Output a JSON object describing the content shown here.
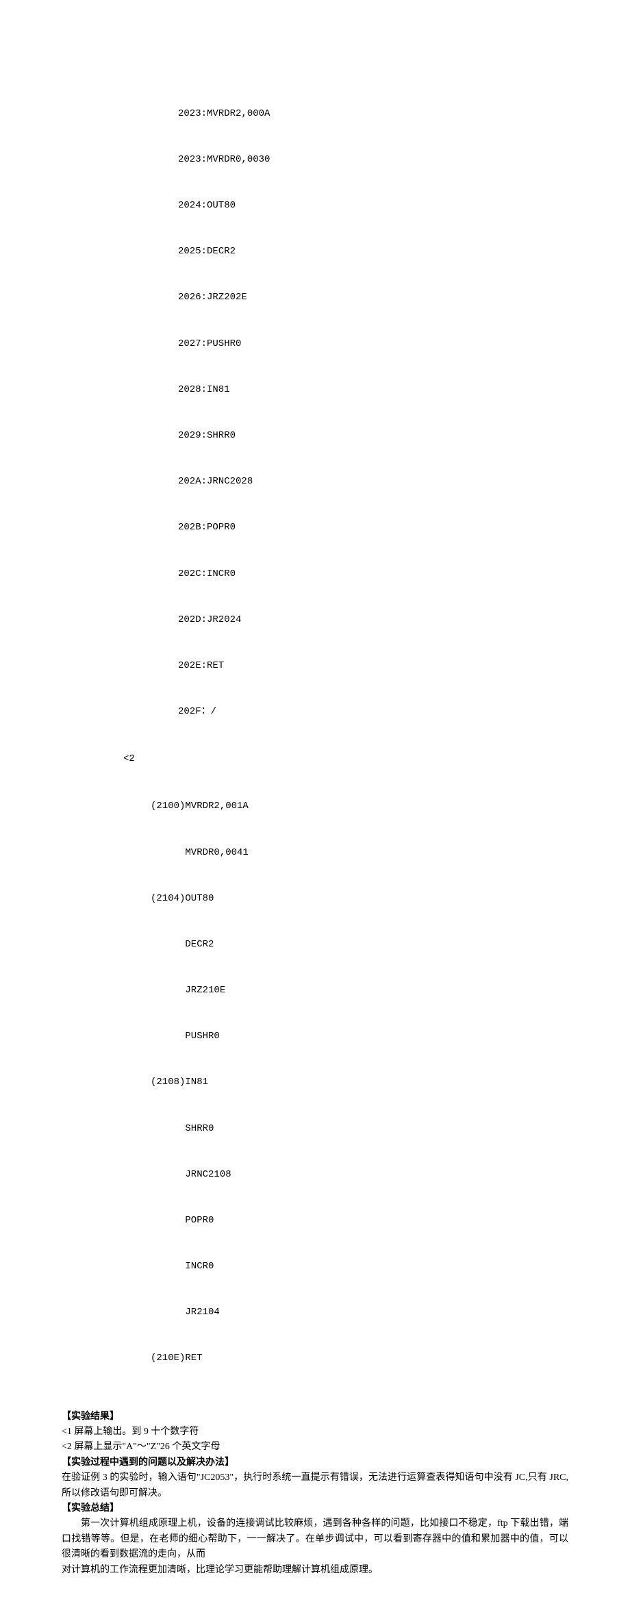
{
  "code1": {
    "l0": "2023:MVRDR2,000A",
    "l1": "2023:MVRDR0,0030",
    "l2": "2024:OUT80",
    "l3": "2025:DECR2",
    "l4": "2026:JRZ202E",
    "l5": "2027:PUSHR0",
    "l6": "2028:IN81",
    "l7": "2029:SHRR0",
    "l8": "202A:JRNC2028",
    "l9": "202B:POPR0",
    "l10": "202C:INCR0",
    "l11": "202D:JR2024",
    "l12": "202E:RET",
    "l13": "202F：/"
  },
  "lt2_label": "<2",
  "code2": {
    "l0": "(2100)MVRDR2,001A",
    "l1": "      MVRDR0,0041",
    "l2": "(2104)OUT80",
    "l3": "      DECR2",
    "l4": "      JRZ210E",
    "l5": "      PUSHR0",
    "l6": "(2108)IN81",
    "l7": "      SHRR0",
    "l8": "      JRNC2108",
    "l9": "      POPR0",
    "l10": "      INCR0",
    "l11": "      JR2104",
    "l12": "(210E)RET"
  },
  "sections": {
    "results_heading": "【实验结果】",
    "results_line1": "<1 屏幕上输出。到 9 十个数字符",
    "results_line2": "<2 屏幕上显示\"A\"～\"Z\"26 个英文字母",
    "problems_heading": "【实验过程中遇到的问题以及解决办法】",
    "problems_line1": "在验证例 3 的实验时，输入语句\"JC2053\"，执行时系统一直提示有错误，无法进行运算查表得知语句中没有 JC,只有 JRC,所以修改语句即可解决。",
    "summary_heading": "【实验总结】",
    "summary_para1": "第一次计算机组成原理上机，设备的连接调试比较麻烦，遇到各种各样的问题，比如接口不稳定，ftp 下载出错，端口找错等等。但是，在老师的细心帮助下，一一解决了。在单步调试中，可以看到寄存器中的值和累加器中的值，可以很清晰的看到数据流的走向，从而",
    "summary_para2": "对计算机的工作流程更加清晰，比理论学习更能帮助理解计算机组成原理。"
  }
}
